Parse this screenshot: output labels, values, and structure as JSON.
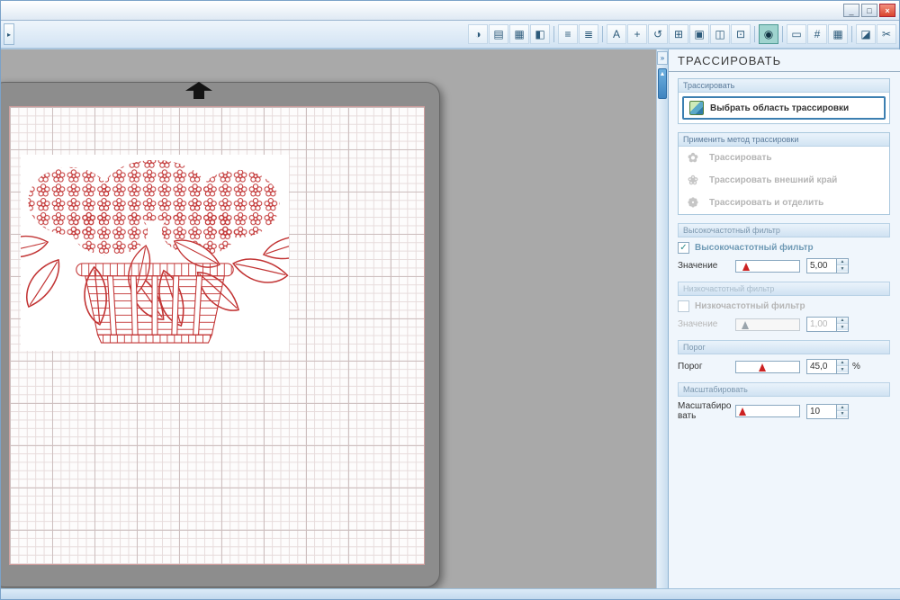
{
  "window": {
    "buttons": {
      "minimize": "_",
      "maximize": "□",
      "close": "×"
    }
  },
  "toolbar": {
    "left_glyph": "▸",
    "icons": [
      {
        "name": "shadow-panel-icon",
        "glyph": "◑"
      },
      {
        "name": "fill-color-panel-icon",
        "glyph": "▤"
      },
      {
        "name": "pattern-fill-panel-icon",
        "glyph": "▦"
      },
      {
        "name": "gradient-fill-panel-icon",
        "glyph": "◧"
      },
      {
        "name": "sep"
      },
      {
        "name": "line-style-panel-icon",
        "glyph": "≡"
      },
      {
        "name": "line-width-panel-icon",
        "glyph": "≣"
      },
      {
        "name": "sep"
      },
      {
        "name": "text-style-panel-icon",
        "glyph": "A"
      },
      {
        "name": "transform-panel-icon",
        "glyph": "+"
      },
      {
        "name": "rotate-panel-icon",
        "glyph": "↺"
      },
      {
        "name": "align-panel-icon",
        "glyph": "⊞"
      },
      {
        "name": "replicate-panel-icon",
        "glyph": "▣"
      },
      {
        "name": "modify-panel-icon",
        "glyph": "◫"
      },
      {
        "name": "object-properties-panel-icon",
        "glyph": "⊡"
      },
      {
        "name": "sep"
      },
      {
        "name": "trace-panel-icon",
        "glyph": "◉",
        "active": true
      },
      {
        "name": "sep"
      },
      {
        "name": "page-setup-panel-icon",
        "glyph": "▭"
      },
      {
        "name": "registration-marks-panel-icon",
        "glyph": "#"
      },
      {
        "name": "grid-settings-panel-icon",
        "glyph": "▦"
      },
      {
        "name": "sep"
      },
      {
        "name": "eraser-tool-icon",
        "glyph": "◪"
      },
      {
        "name": "knife-tool-icon",
        "glyph": "✂"
      }
    ]
  },
  "splitter": {
    "collapse_glyph": "»",
    "handle_glyph": "▲"
  },
  "ui": {
    "check": "✓",
    "spin_up": "▲",
    "spin_down": "▼"
  },
  "panel": {
    "title": "ТРАССИРОВАТЬ",
    "trace_group": {
      "header": "Трассировать",
      "select_button": "Выбрать область трассировки"
    },
    "method_group": {
      "header": "Применить метод трассировки",
      "options": [
        {
          "glyph": "✿",
          "label": "Трассировать"
        },
        {
          "glyph": "❀",
          "label": "Трассировать внешний край"
        },
        {
          "glyph": "❁",
          "label": "Трассировать и отделить"
        }
      ]
    },
    "high_pass": {
      "header": "Высокочастотный фильтр",
      "checkbox_label": "Высокочастотный фильтр",
      "checked": true,
      "value_label": "Значение",
      "value": "5,00"
    },
    "low_pass": {
      "header": "Низкочастотный фильтр",
      "checkbox_label": "Низкочастотный фильтр",
      "checked": false,
      "value_label": "Значение",
      "value": "1,00"
    },
    "threshold": {
      "header": "Порог",
      "label": "Порог",
      "value": "45,0",
      "unit": "%"
    },
    "scale": {
      "header": "Масштабировать",
      "label": "Масштабировать",
      "value": "10"
    }
  }
}
